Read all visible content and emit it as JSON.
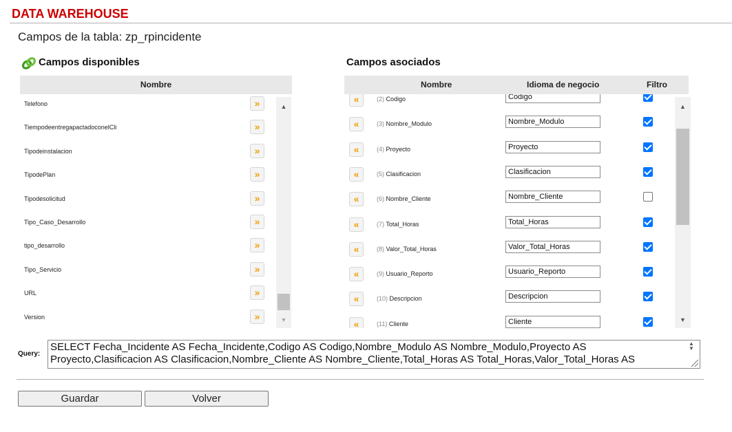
{
  "app": {
    "title": "DATA WAREHOUSE"
  },
  "page": {
    "table_title": "Campos de la tabla: zp_rpincidente"
  },
  "available": {
    "title": "Campos disponibles",
    "icon": "link-icon",
    "column_header": "Nombre",
    "fields": [
      "Telefono",
      "TiempodeentregapactadoconelCli",
      "Tipodeinstalacion",
      "TipodePlan",
      "Tipodesolicitud",
      "Tipo_Caso_Desarrollo",
      "tipo_desarrollo",
      "Tipo_Servicio",
      "URL",
      "Version"
    ]
  },
  "associated": {
    "title": "Campos asociados",
    "headers": {
      "name": "Nombre",
      "business": "Idioma de negocio",
      "filter": "Filtro"
    },
    "rows": [
      {
        "num": "(2)",
        "name": "Codigo",
        "business": "Codigo",
        "filter": true
      },
      {
        "num": "(3)",
        "name": "Nombre_Modulo",
        "business": "Nombre_Modulo",
        "filter": true
      },
      {
        "num": "(4)",
        "name": "Proyecto",
        "business": "Proyecto",
        "filter": true
      },
      {
        "num": "(5)",
        "name": "Clasificacion",
        "business": "Clasificacion",
        "filter": true
      },
      {
        "num": "(6)",
        "name": "Nombre_Cliente",
        "business": "Nombre_Cliente",
        "filter": false
      },
      {
        "num": "(7)",
        "name": "Total_Horas",
        "business": "Total_Horas",
        "filter": true
      },
      {
        "num": "(8)",
        "name": "Valor_Total_Horas",
        "business": "Valor_Total_Horas",
        "filter": true
      },
      {
        "num": "(9)",
        "name": "Usuario_Reporto",
        "business": "Usuario_Reporto",
        "filter": true
      },
      {
        "num": "(10)",
        "name": "Descripcion",
        "business": "Descripcion",
        "filter": true
      },
      {
        "num": "(11)",
        "name": "Cliente",
        "business": "Cliente",
        "filter": true
      }
    ]
  },
  "query": {
    "label": "Query:",
    "value": "SELECT Fecha_Incidente AS Fecha_Incidente,Codigo AS Codigo,Nombre_Modulo AS Nombre_Modulo,Proyecto AS Proyecto,Clasificacion AS Clasificacion,Nombre_Cliente AS Nombre_Cliente,Total_Horas AS Total_Horas,Valor_Total_Horas AS"
  },
  "buttons": {
    "save": "Guardar",
    "back": "Volver"
  },
  "icons": {
    "add": "double-arrow-right-icon",
    "remove": "double-arrow-left-icon"
  },
  "colors": {
    "brand": "#cc0000",
    "arrow": "#f0a000",
    "checkbox": "#0075ff"
  }
}
